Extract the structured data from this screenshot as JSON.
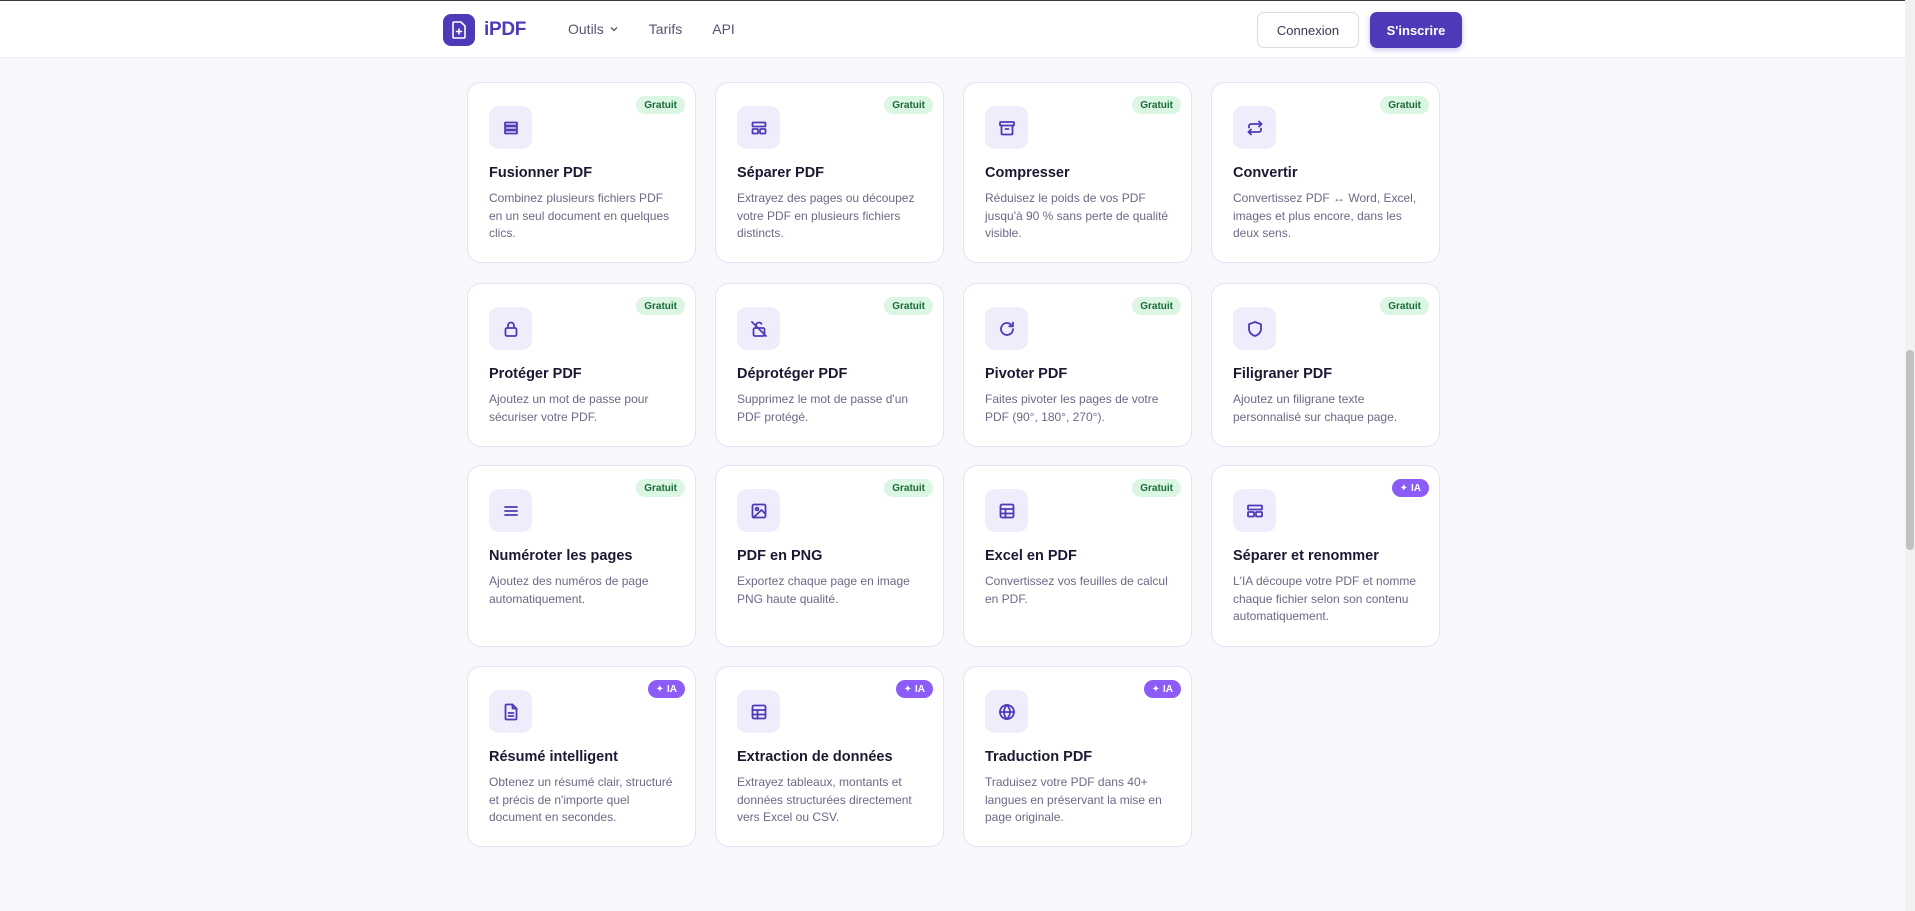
{
  "brand": {
    "name": "iPDF",
    "accent": "#4f39b8"
  },
  "nav": {
    "tools": "Outils",
    "pricing": "Tarifs",
    "api": "API"
  },
  "actions": {
    "login": "Connexion",
    "signup": "S'inscrire"
  },
  "badges": {
    "free": "Gratuit",
    "ai": "IA"
  },
  "tools": [
    {
      "title": "Fusionner PDF",
      "desc": "Combinez plusieurs fichiers PDF en un seul document en quelques clics.",
      "badge": "Gratuit",
      "icon": "layers-icon"
    },
    {
      "title": "Séparer PDF",
      "desc": "Extrayez des pages ou découpez votre PDF en plusieurs fichiers distincts.",
      "badge": "Gratuit",
      "icon": "split-icon"
    },
    {
      "title": "Compresser",
      "desc": "Réduisez le poids de vos PDF jusqu'à 90 % sans perte de qualité visible.",
      "badge": "Gratuit",
      "icon": "archive-icon"
    },
    {
      "title": "Convertir",
      "desc": "Convertissez PDF ↔ Word, Excel, images et plus encore, dans les deux sens.",
      "badge": "Gratuit",
      "icon": "convert-icon"
    },
    {
      "title": "Protéger PDF",
      "desc": "Ajoutez un mot de passe pour sécuriser votre PDF.",
      "badge": "Gratuit",
      "icon": "lock-icon"
    },
    {
      "title": "Déprotéger PDF",
      "desc": "Supprimez le mot de passe d'un PDF protégé.",
      "badge": "Gratuit",
      "icon": "unlock-icon"
    },
    {
      "title": "Pivoter PDF",
      "desc": "Faites pivoter les pages de votre PDF (90°, 180°, 270°).",
      "badge": "Gratuit",
      "icon": "rotate-icon"
    },
    {
      "title": "Filigraner PDF",
      "desc": "Ajoutez un filigrane texte personnalisé sur chaque page.",
      "badge": "Gratuit",
      "icon": "shield-icon"
    },
    {
      "title": "Numéroter les pages",
      "desc": "Ajoutez des numéros de page automatiquement.",
      "badge": "Gratuit",
      "icon": "list-icon"
    },
    {
      "title": "PDF en PNG",
      "desc": "Exportez chaque page en image PNG haute qualité.",
      "badge": "Gratuit",
      "icon": "image-icon"
    },
    {
      "title": "Excel en PDF",
      "desc": "Convertissez vos feuilles de calcul en PDF.",
      "badge": "Gratuit",
      "icon": "sheet-icon"
    },
    {
      "title": "Séparer et renommer",
      "desc": "L'IA découpe votre PDF et nomme chaque fichier selon son contenu automatiquement.",
      "badge": "IA",
      "icon": "split-rename-icon"
    },
    {
      "title": "Résumé intelligent",
      "desc": "Obtenez un résumé clair, structuré et précis de n'importe quel document en secondes.",
      "badge": "IA",
      "icon": "document-icon"
    },
    {
      "title": "Extraction de données",
      "desc": "Extrayez tableaux, montants et données structurées directement vers Excel ou CSV.",
      "badge": "IA",
      "icon": "table-icon"
    },
    {
      "title": "Traduction PDF",
      "desc": "Traduisez votre PDF dans 40+ langues en préservant la mise en page originale.",
      "badge": "IA",
      "icon": "globe-icon"
    }
  ]
}
